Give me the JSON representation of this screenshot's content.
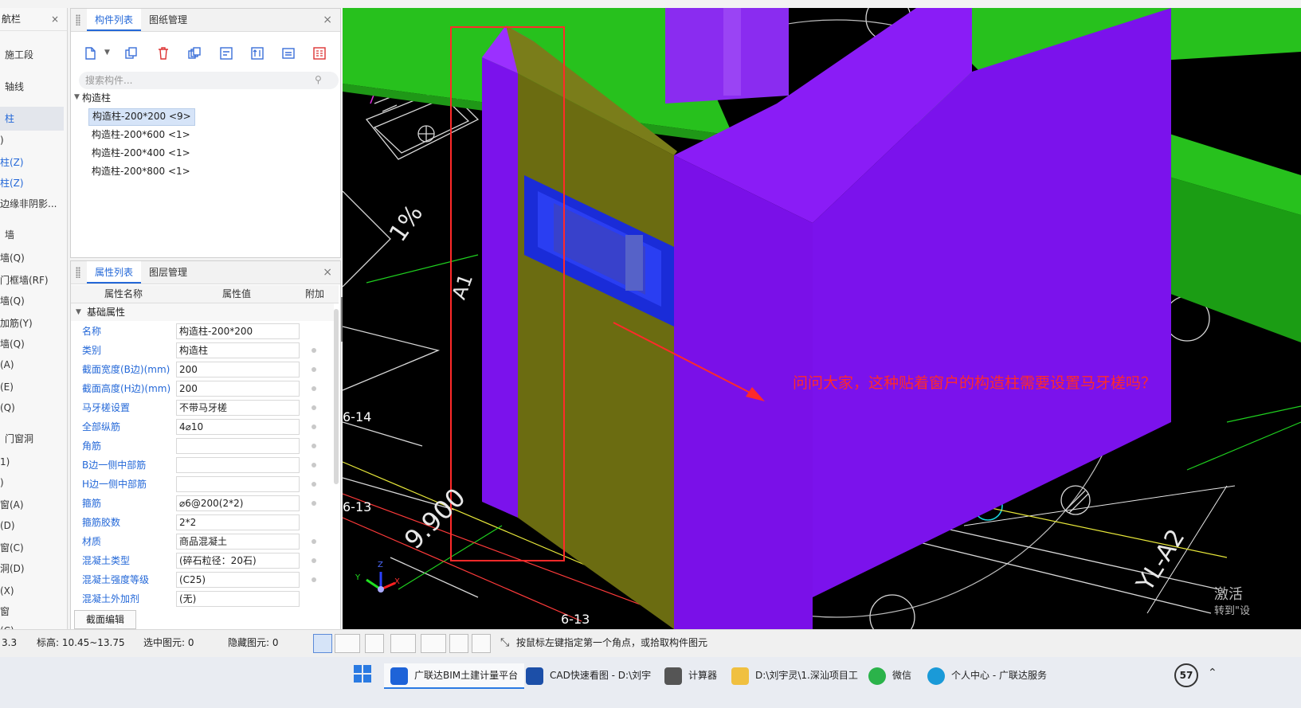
{
  "nav": {
    "title": "航栏",
    "close": "×",
    "items": [
      "施工段",
      "轴线",
      "柱",
      ")",
      "柱(Z)",
      "柱(Z)",
      "边缘非阴影...",
      "墙",
      "墙(Q)",
      "门框墙(RF)",
      "墙(Q)",
      "加筋(Y)",
      "墙(Q)",
      "(A)",
      "(E)",
      "(Q)",
      "门窗洞",
      "1)",
      ")",
      "窗(A)",
      "(D)",
      "窗(C)",
      "洞(D)",
      "(X)",
      "窗",
      "(C)"
    ]
  },
  "component_panel": {
    "tabs": [
      "构件列表",
      "图纸管理"
    ],
    "close": "×",
    "search_placeholder": "搜索构件...",
    "tree_root": "构造柱",
    "items": [
      "构造柱-200*200 <9>",
      "构造柱-200*600 <1>",
      "构造柱-200*400 <1>",
      "构造柱-200*800 <1>"
    ]
  },
  "property_panel": {
    "tabs": [
      "属性列表",
      "图层管理"
    ],
    "close": "×",
    "columns": [
      "属性名称",
      "属性值",
      "附加"
    ],
    "group": "基础属性",
    "rows": [
      {
        "name": "名称",
        "value": "构造柱-200*200"
      },
      {
        "name": "类别",
        "value": "构造柱"
      },
      {
        "name": "截面宽度(B边)(mm)",
        "value": "200"
      },
      {
        "name": "截面高度(H边)(mm)",
        "value": "200"
      },
      {
        "name": "马牙槎设置",
        "value": "不带马牙槎"
      },
      {
        "name": "全部纵筋",
        "value": "4⌀10"
      },
      {
        "name": "角筋",
        "value": ""
      },
      {
        "name": "B边一侧中部筋",
        "value": ""
      },
      {
        "name": "H边一侧中部筋",
        "value": ""
      },
      {
        "name": "箍筋",
        "value": "⌀6@200(2*2)"
      },
      {
        "name": "箍筋胶数",
        "value": "2*2"
      },
      {
        "name": "材质",
        "value": "商品混凝土"
      },
      {
        "name": "混凝土类型",
        "value": "(碎石粒径：20石)"
      },
      {
        "name": "混凝土强度等级",
        "value": "(C25)"
      },
      {
        "name": "混凝土外加剂",
        "value": "(无)"
      }
    ],
    "section_edit_button": "截面编辑"
  },
  "viewport": {
    "question": "问问大家，这种贴着窗户的构造柱需要设置马牙槎吗？",
    "labels": [
      "6-14",
      "6-13",
      "6-13",
      "9.900",
      "1%",
      "YL-A2",
      "A1"
    ],
    "watermark": [
      "激活",
      "转到\"设"
    ],
    "axis": [
      "X",
      "Y",
      "Z"
    ]
  },
  "status_bar": {
    "coord": "3.3",
    "elevation": "标高:   10.45~13.75",
    "selected": "选中图元:   0",
    "hidden": "隐藏图元:   0",
    "hint": "按鼠标左键指定第一个角点，或拾取构件图元"
  },
  "taskbar": {
    "apps": [
      "广联达BIM土建计量平台",
      "CAD快速看图 - D:\\刘宇",
      "计算器",
      "D:\\刘宇灵\\1.深汕项目工",
      "微信",
      "个人中心 - 广联达服务"
    ],
    "badge": "57"
  },
  "colors": {
    "accent": "#2468d8",
    "purple": "#7a14f0",
    "green": "#28c21e",
    "question_red": "#ff2a2a"
  }
}
